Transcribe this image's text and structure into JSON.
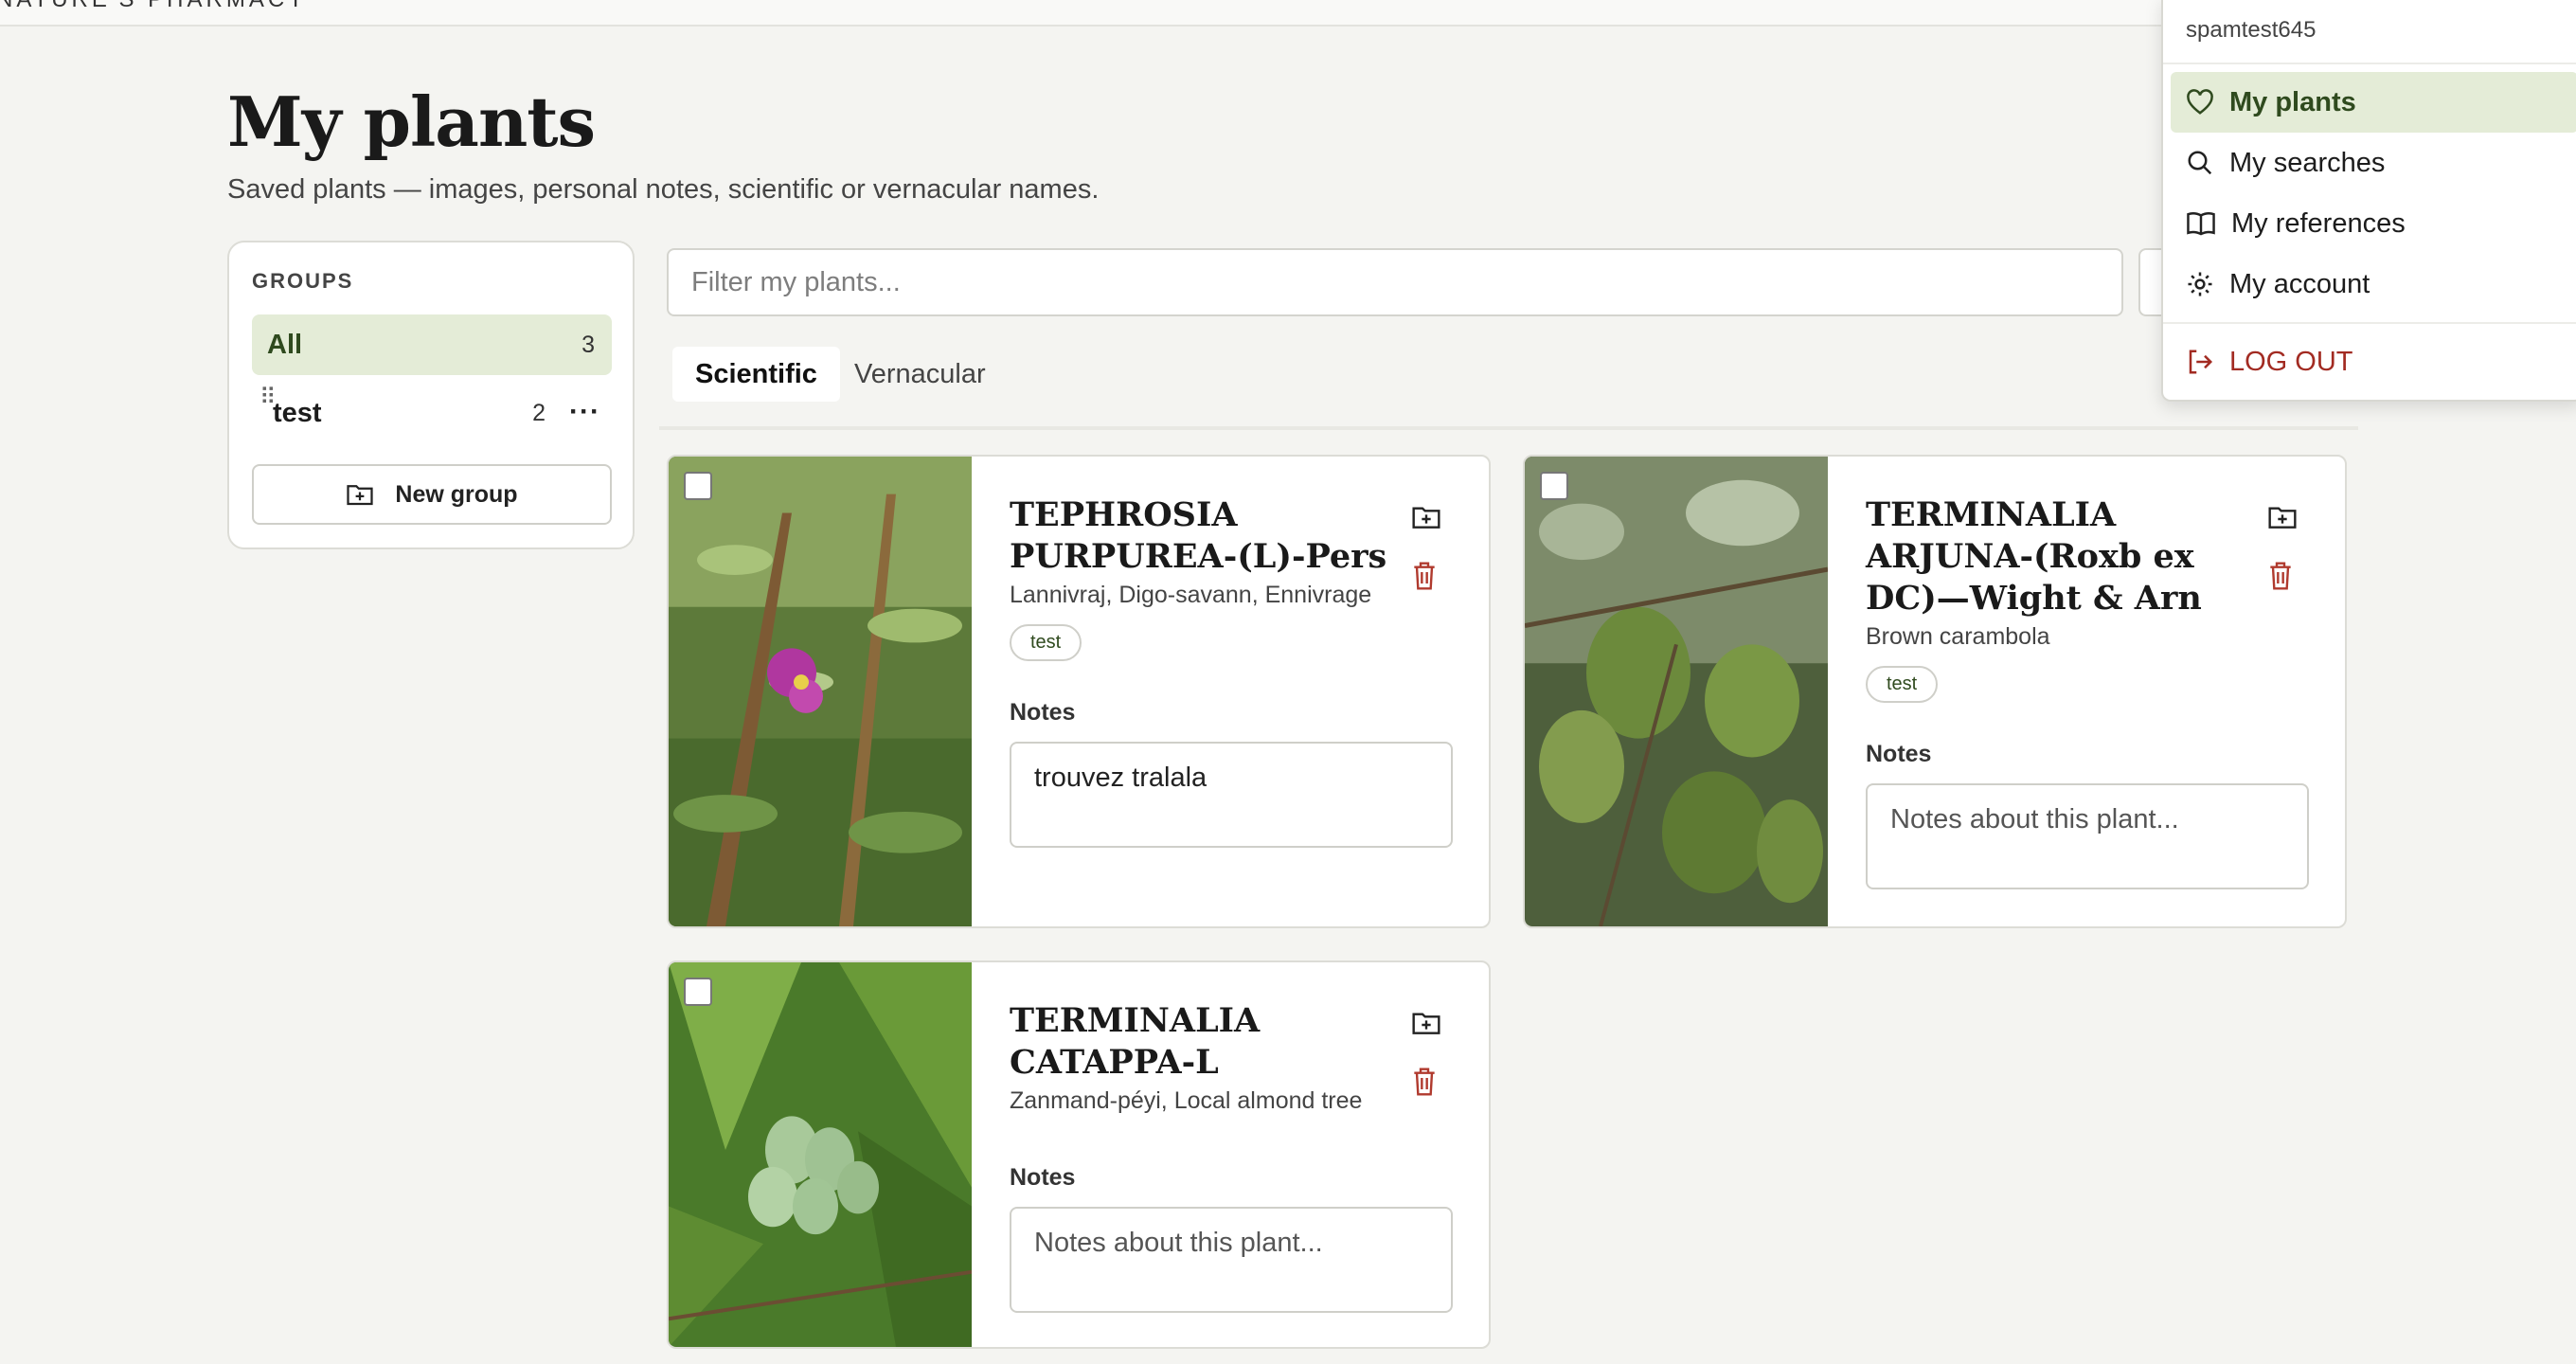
{
  "header": {
    "brand": "NATURE'S PHARMACY"
  },
  "page": {
    "title": "My plants",
    "subtitle": "Saved plants — images, personal notes, scientific or vernacular names."
  },
  "groups": {
    "heading": "GROUPS",
    "items": [
      {
        "name": "All",
        "count": "3"
      },
      {
        "name": "test",
        "count": "2"
      }
    ],
    "new_group_label": "New group"
  },
  "filter": {
    "placeholder": "Filter my plants..."
  },
  "tabs": [
    {
      "label": "Scientific"
    },
    {
      "label": "Vernacular"
    }
  ],
  "cards": [
    {
      "title": "TEPHROSIA PURPUREA-(L)-Pers",
      "vernacular": "Lannivraj, Digo-savann, Ennivrage",
      "tag": "test",
      "notes_label": "Notes",
      "notes_value": "trouvez tralala",
      "notes_placeholder": "Notes about this plant..."
    },
    {
      "title": "TERMINALIA ARJUNA-(Roxb ex DC)—Wight & Arn",
      "vernacular": "Brown carambola",
      "tag": "test",
      "notes_label": "Notes",
      "notes_value": "",
      "notes_placeholder": "Notes about this plant..."
    },
    {
      "title": "TERMINALIA CATAPPA-L",
      "vernacular": "Zanmand-péyi, Local almond tree",
      "tag": "",
      "notes_label": "Notes",
      "notes_value": "",
      "notes_placeholder": "Notes about this plant..."
    }
  ],
  "menu": {
    "username": "spamtest645",
    "items": [
      {
        "label": "My plants",
        "icon": "heart-icon"
      },
      {
        "label": "My searches",
        "icon": "search-icon"
      },
      {
        "label": "My references",
        "icon": "book-icon"
      },
      {
        "label": "My account",
        "icon": "gear-icon"
      }
    ],
    "logout_label": "LOG OUT"
  },
  "colors": {
    "accent_bg": "#e4ecd7",
    "accent_text": "#2f4a1e",
    "danger": "#a22b22",
    "page_bg": "#f4f4f1"
  }
}
